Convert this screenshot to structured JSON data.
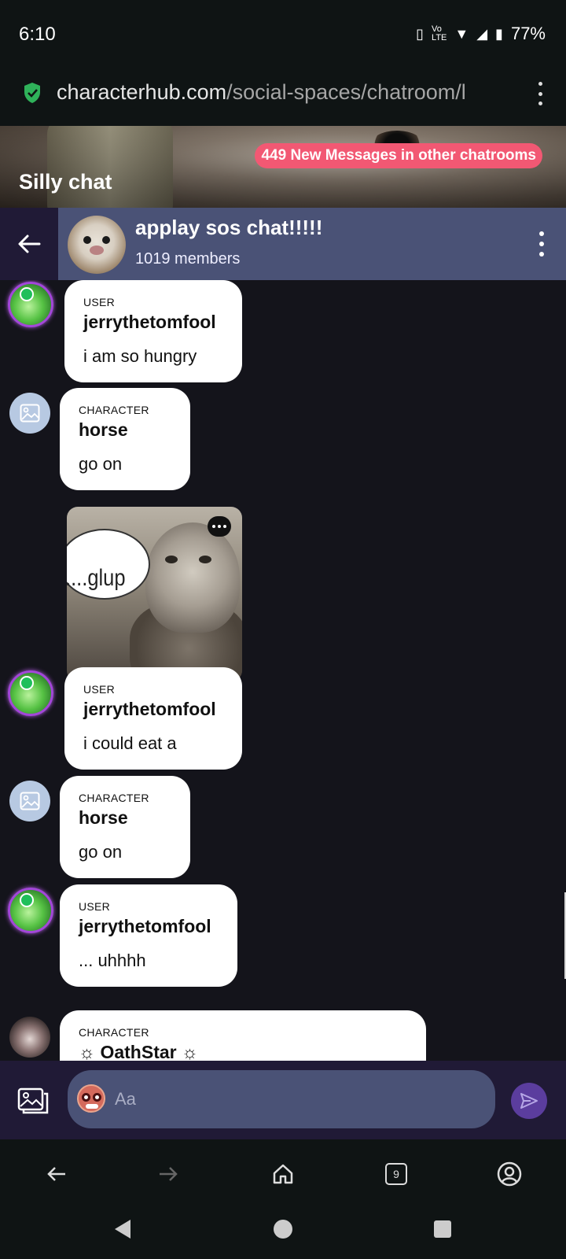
{
  "status": {
    "time": "6:10",
    "battery": "77%"
  },
  "browser": {
    "url_domain": "characterhub.com",
    "url_path": "/social-spaces/chatroom/l",
    "tab_count": "9"
  },
  "banner": {
    "title": "Silly chat",
    "new_messages": "449 New Messages in other chatrooms"
  },
  "chat": {
    "title": "applay sos chat!!!!!",
    "members": "1019 members"
  },
  "messages": [
    {
      "role": "USER",
      "name": "jerrythetomfool",
      "text": "i am so hungry"
    },
    {
      "role": "CHARACTER",
      "name": "horse",
      "text": "go on"
    },
    {
      "role": "USER",
      "name": "jerrythetomfool",
      "text": "i could eat a"
    },
    {
      "role": "CHARACTER",
      "name": "horse",
      "text": "go on"
    },
    {
      "role": "USER",
      "name": "jerrythetomfool",
      "text": "... uhhhh"
    },
    {
      "role": "CHARACTER",
      "name": "☼ OathStar ☼",
      "text": ""
    }
  ],
  "image_message": {
    "caption": "....glup"
  },
  "composer": {
    "placeholder": "Aa"
  },
  "colors": {
    "header": "#4a5276",
    "badge": "#f25873",
    "avatar_ring": "#a347d9",
    "send": "#5b3d9e"
  }
}
